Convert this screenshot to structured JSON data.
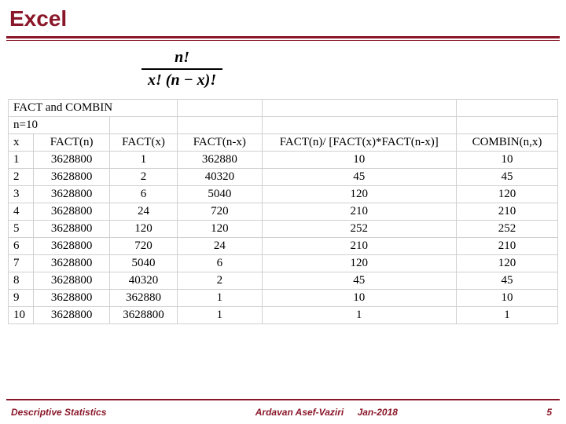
{
  "title": "Excel",
  "formula": {
    "numerator": "n!",
    "denominator": "x! (n − x)!"
  },
  "table": {
    "section_label": "FACT and COMBIN",
    "n_label": "n=10",
    "headers": [
      "x",
      "FACT(n)",
      "FACT(x)",
      "FACT(n-x)",
      "FACT(n)/ [FACT(x)*FACT(n-x)]",
      "COMBIN(n,x)"
    ],
    "rows": [
      {
        "x": "1",
        "fn": "3628800",
        "fx": "1",
        "fnx": "362880",
        "div": "10",
        "comb": "10"
      },
      {
        "x": "2",
        "fn": "3628800",
        "fx": "2",
        "fnx": "40320",
        "div": "45",
        "comb": "45"
      },
      {
        "x": "3",
        "fn": "3628800",
        "fx": "6",
        "fnx": "5040",
        "div": "120",
        "comb": "120"
      },
      {
        "x": "4",
        "fn": "3628800",
        "fx": "24",
        "fnx": "720",
        "div": "210",
        "comb": "210"
      },
      {
        "x": "5",
        "fn": "3628800",
        "fx": "120",
        "fnx": "120",
        "div": "252",
        "comb": "252"
      },
      {
        "x": "6",
        "fn": "3628800",
        "fx": "720",
        "fnx": "24",
        "div": "210",
        "comb": "210"
      },
      {
        "x": "7",
        "fn": "3628800",
        "fx": "5040",
        "fnx": "6",
        "div": "120",
        "comb": "120"
      },
      {
        "x": "8",
        "fn": "3628800",
        "fx": "40320",
        "fnx": "2",
        "div": "45",
        "comb": "45"
      },
      {
        "x": "9",
        "fn": "3628800",
        "fx": "362880",
        "fnx": "1",
        "div": "10",
        "comb": "10"
      },
      {
        "x": "10",
        "fn": "3628800",
        "fx": "3628800",
        "fnx": "1",
        "div": "1",
        "comb": "1"
      }
    ]
  },
  "footer": {
    "left": "Descriptive Statistics",
    "author": "Ardavan Asef-Vaziri",
    "date": "Jan-2018",
    "page": "5"
  }
}
